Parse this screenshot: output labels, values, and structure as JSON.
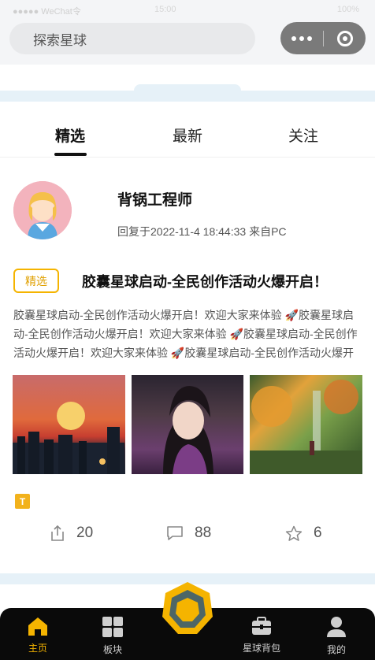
{
  "status": {
    "left": "●●●●● WeChat令",
    "time": "15:00",
    "right": "100%"
  },
  "search": {
    "placeholder": "探索星球"
  },
  "tabs": [
    {
      "label": "精选",
      "active": true
    },
    {
      "label": "最新",
      "active": false
    },
    {
      "label": "关注",
      "active": false
    }
  ],
  "post": {
    "author": "背锅工程师",
    "meta": "回复于2022-11-4 18:44:33 来自PC",
    "badge": "精选",
    "title": "胶囊星球启动-全民创作活动火爆开启！",
    "body": "胶囊星球启动-全民创作活动火爆开启！欢迎大家来体验 🚀胶囊星球启动-全民创作活动火爆开启！欢迎大家来体验 🚀胶囊星球启动-全民创作活动火爆开启！欢迎大家来体验 🚀胶囊星球启动-全民创作活动火爆开启！欢迎大家来体验",
    "tag_icon": "T",
    "share_count": "20",
    "comment_count": "88",
    "star_count": "6"
  },
  "tabbar": {
    "items": [
      {
        "label": "主页",
        "icon": "home-icon",
        "active": true
      },
      {
        "label": "板块",
        "icon": "grid-icon",
        "active": false
      },
      {
        "label": "星球背包",
        "icon": "backpack-icon",
        "active": false
      },
      {
        "label": "我的",
        "icon": "user-icon",
        "active": false
      }
    ]
  },
  "colors": {
    "accent": "#f5b400",
    "tabbar_bg": "#0a0a0a",
    "band": "#e6f1f8"
  }
}
